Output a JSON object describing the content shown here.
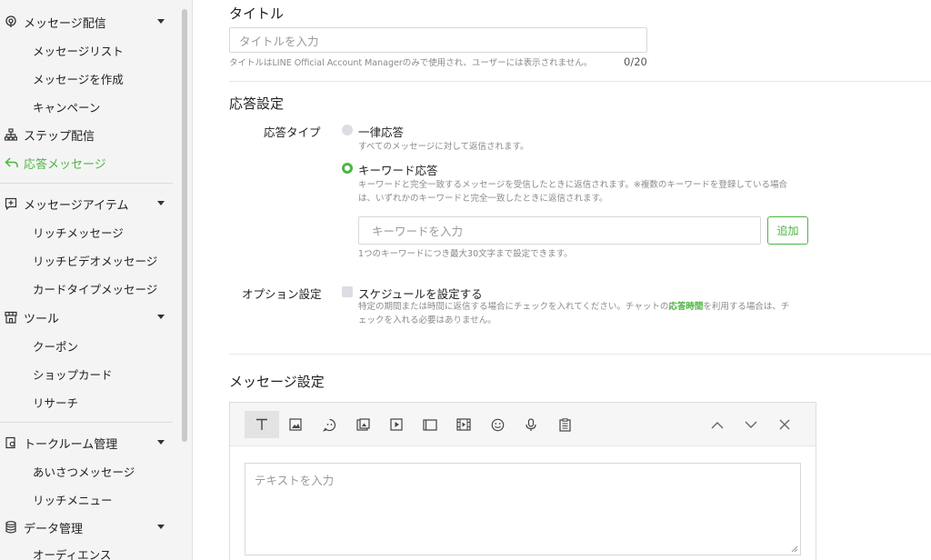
{
  "sidebar": {
    "sections": [
      {
        "label": "メッセージ配信",
        "icon": "broadcast-icon",
        "items": [
          "メッセージリスト",
          "メッセージを作成",
          "キャンペーン"
        ]
      },
      {
        "label": "ステップ配信",
        "icon": "step-tree-icon"
      },
      {
        "label": "応答メッセージ",
        "icon": "reply-icon",
        "active": true
      },
      {
        "label": "メッセージアイテム",
        "icon": "message-item-icon",
        "items": [
          "リッチメッセージ",
          "リッチビデオメッセージ",
          "カードタイプメッセージ"
        ]
      },
      {
        "label": "ツール",
        "icon": "store-icon",
        "items": [
          "クーポン",
          "ショップカード",
          "リサーチ"
        ]
      },
      {
        "label": "トークルーム管理",
        "icon": "chatroom-icon",
        "items": [
          "あいさつメッセージ",
          "リッチメニュー"
        ]
      },
      {
        "label": "データ管理",
        "icon": "database-icon",
        "items": [
          "オーディエンス"
        ]
      }
    ]
  },
  "title_section": {
    "heading": "タイトル",
    "placeholder": "タイトルを入力",
    "help": "タイトルはLINE Official Account Managerのみで使用され、ユーザーには表示されません。",
    "counter": "0/20"
  },
  "response_section": {
    "heading": "応答設定",
    "type_label": "応答タイプ",
    "option1": {
      "label": "一律応答",
      "desc": "すべてのメッセージに対して返信されます。"
    },
    "option2": {
      "label": "キーワード応答",
      "desc_line1": "キーワードと完全一致するメッセージを受信したときに返信されます。※複数のキーワードを登録している場合",
      "desc_line2": "は、いずれかのキーワードと完全一致したときに返信されます。"
    },
    "keyword_placeholder": "キーワードを入力",
    "add_button": "追加",
    "keyword_help": "1つのキーワードにつき最大30文字まで設定できます。",
    "option_label": "オプション設定",
    "schedule_label": "スケジュールを設定する",
    "schedule_help_a": "特定の期間または時間に返信する場合にチェックを入れてください。チャットの",
    "schedule_help_link": "応答時間",
    "schedule_help_b": "を利用する場合は、チ",
    "schedule_help_line2": "ェックを入れる必要はありません。"
  },
  "message_section": {
    "heading": "メッセージ設定",
    "text_placeholder": "テキストを入力"
  },
  "colors": {
    "accent": "#4cb642"
  }
}
